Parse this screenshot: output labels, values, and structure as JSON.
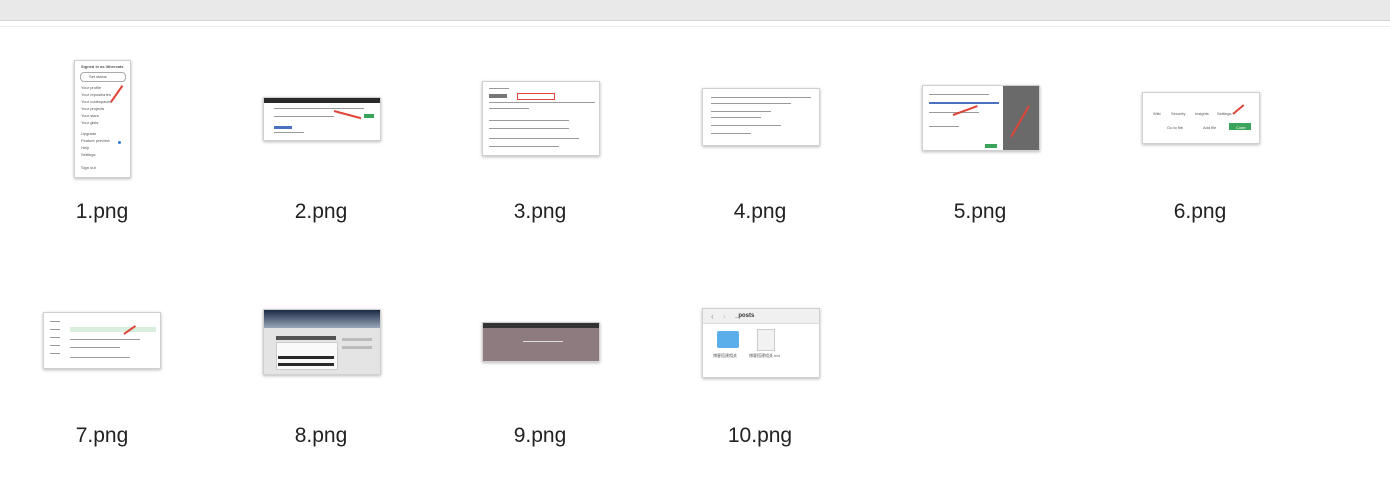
{
  "files": [
    {
      "name": "1.png"
    },
    {
      "name": "2.png"
    },
    {
      "name": "3.png"
    },
    {
      "name": "4.png"
    },
    {
      "name": "5.png"
    },
    {
      "name": "6.png"
    },
    {
      "name": "7.png"
    },
    {
      "name": "8.png"
    },
    {
      "name": "9.png"
    },
    {
      "name": "10.png"
    }
  ],
  "thumb1": {
    "header": "Signed in as lithercats",
    "status": "Set status",
    "menu": [
      "Your profile",
      "Your repositories",
      "Your codespaces",
      "Your projects",
      "Your stars",
      "Your gists",
      "Upgrade",
      "Feature preview",
      "Help",
      "Settings",
      "Sign out"
    ]
  },
  "thumb6": {
    "tabs": [
      "Wiki",
      "Security",
      "Insights",
      "Settings"
    ],
    "buttons": [
      "Go to file",
      "Add file",
      "Code"
    ]
  },
  "thumb10": {
    "folder_path": "_posts",
    "items": [
      "博客搭建相关",
      "博客搭建相关.md"
    ]
  }
}
